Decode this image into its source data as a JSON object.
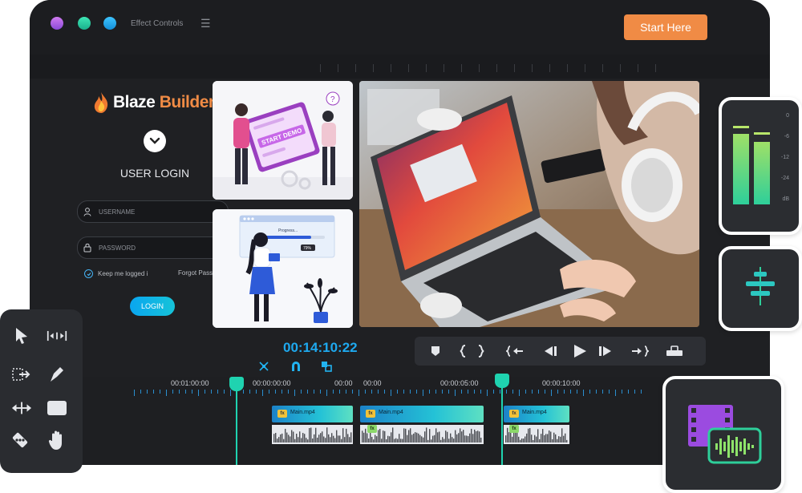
{
  "topbar": {
    "menu_title": "Effect Controls",
    "start_button": "Start Here",
    "window_dots": [
      "#b560e8",
      "#27d3a0",
      "#1fb0f0"
    ]
  },
  "login": {
    "brand_left": "Blaze",
    "brand_right": "Builder",
    "title": "USER LOGIN",
    "username_placeholder": "USERNAME",
    "password_placeholder": "PASSWORD",
    "remember_label": "Keep me logged i",
    "forgot_label": "Forgot Password",
    "login_button": "LOGIN"
  },
  "preview": {
    "demo_button": "START DEMO",
    "progress_label": "Progress...",
    "progress_value": "79%"
  },
  "player": {
    "timecode": "00:14:10:22"
  },
  "timeline": {
    "labels": [
      "00:01:00:00",
      "00:00:00:00",
      "00:00",
      "00:00",
      "00:00:05:00",
      "00:00:10:00"
    ],
    "clips": [
      {
        "name": "Main.mp4"
      },
      {
        "name": "Main.mp4"
      },
      {
        "name": "Main.mp4"
      }
    ]
  },
  "meter": {
    "scale": [
      "0",
      "-6",
      "-12",
      "-24",
      "dB"
    ]
  },
  "icons": {
    "tools": [
      "select-arrow-icon",
      "ripple-edit-icon",
      "track-select-icon",
      "pen-icon",
      "slip-icon",
      "rectangle-icon",
      "razor-icon",
      "hand-icon"
    ],
    "transport": [
      "marker-icon",
      "in-point-icon",
      "out-point-icon",
      "go-to-in-icon",
      "step-back-icon",
      "play-icon",
      "step-forward-icon",
      "go-to-out-icon",
      "export-frame-icon"
    ],
    "bottom_right": "video-audio-icon",
    "mid_right": "align-icon"
  },
  "colors": {
    "accent_orange": "#f08b45",
    "accent_blue": "#1ea9ef",
    "playhead": "#1fd3b0"
  }
}
